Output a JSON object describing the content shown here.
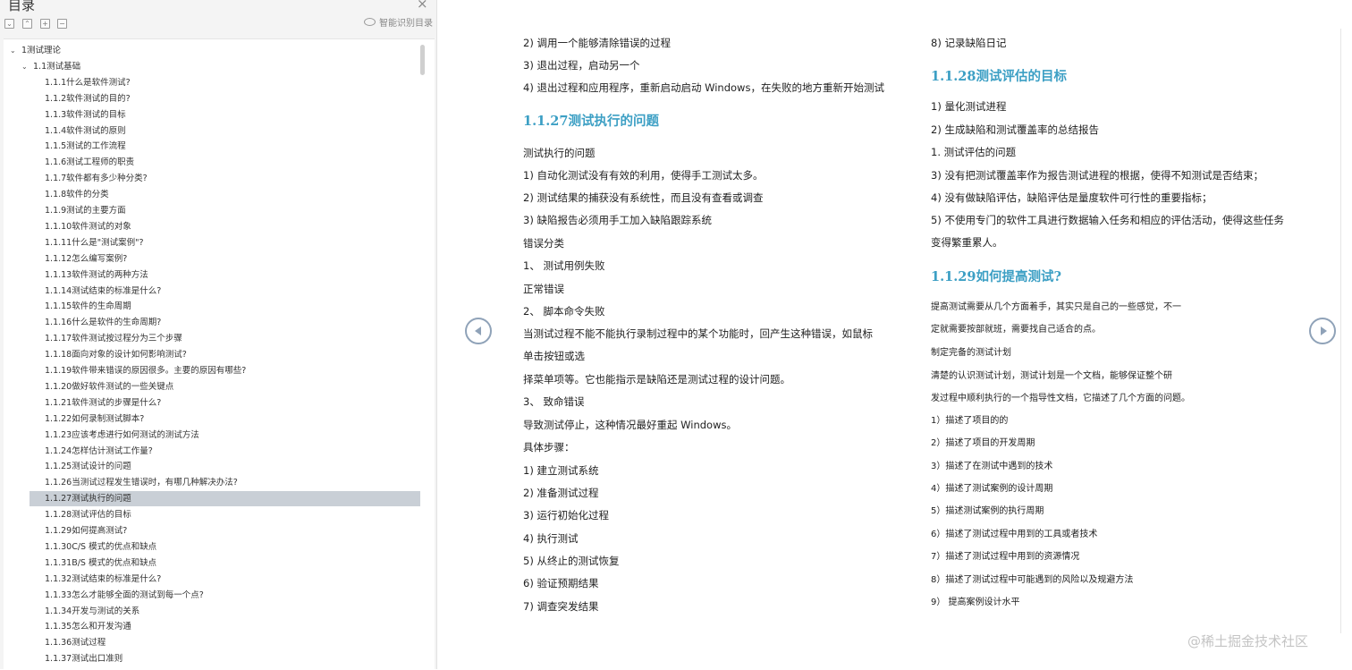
{
  "sidebar": {
    "title": "目录",
    "close_icon": "×",
    "toolbar_icons": [
      "expand-all-icon",
      "collapse-all-icon",
      "add-bookmark-icon",
      "remove-bookmark-icon"
    ],
    "smart_toc_label": "智能识别目录",
    "toc": [
      {
        "label": "1测试理论",
        "level": 0,
        "expanded": true
      },
      {
        "label": "1.1测试基础",
        "level": 1,
        "expanded": true
      },
      {
        "label": "1.1.1什么是软件测试?",
        "level": 2
      },
      {
        "label": "1.1.2软件测试的目的?",
        "level": 2
      },
      {
        "label": "1.1.3软件测试的目标",
        "level": 2
      },
      {
        "label": "1.1.4软件测试的原则",
        "level": 2
      },
      {
        "label": "1.1.5测试的工作流程",
        "level": 2
      },
      {
        "label": "1.1.6测试工程师的职责",
        "level": 2
      },
      {
        "label": "1.1.7软件都有多少种分类?",
        "level": 2
      },
      {
        "label": "1.1.8软件的分类",
        "level": 2
      },
      {
        "label": "1.1.9测试的主要方面",
        "level": 2
      },
      {
        "label": "1.1.10软件测试的对象",
        "level": 2
      },
      {
        "label": "1.1.11什么是\"测试案例\"?",
        "level": 2
      },
      {
        "label": "1.1.12怎么编写案例?",
        "level": 2
      },
      {
        "label": "1.1.13软件测试的两种方法",
        "level": 2
      },
      {
        "label": "1.1.14测试结束的标准是什么?",
        "level": 2
      },
      {
        "label": "1.1.15软件的生命周期",
        "level": 2
      },
      {
        "label": "1.1.16什么是软件的生命周期?",
        "level": 2
      },
      {
        "label": "1.1.17软件测试按过程分为三个步骤",
        "level": 2
      },
      {
        "label": "1.1.18面向对象的设计如何影响测试?",
        "level": 2
      },
      {
        "label": "1.1.19软件带来错误的原因很多。主要的原因有哪些?",
        "level": 2
      },
      {
        "label": "1.1.20做好软件测试的一些关键点",
        "level": 2
      },
      {
        "label": "1.1.21软件测试的步骤是什么?",
        "level": 2
      },
      {
        "label": "1.1.22如何录制测试脚本?",
        "level": 2
      },
      {
        "label": "1.1.23应该考虑进行如何测试的测试方法",
        "level": 2
      },
      {
        "label": "1.1.24怎样估计测试工作量?",
        "level": 2
      },
      {
        "label": "1.1.25测试设计的问题",
        "level": 2
      },
      {
        "label": "1.1.26当测试过程发生错误时，有哪几种解决办法?",
        "level": 2
      },
      {
        "label": "1.1.27测试执行的问题",
        "level": 2,
        "active": true
      },
      {
        "label": "1.1.28测试评估的目标",
        "level": 2
      },
      {
        "label": "1.1.29如何提高测试?",
        "level": 2
      },
      {
        "label": "1.1.30C/S 模式的优点和缺点",
        "level": 2
      },
      {
        "label": "1.1.31B/S 模式的优点和缺点",
        "level": 2
      },
      {
        "label": "1.1.32测试结束的标准是什么?",
        "level": 2
      },
      {
        "label": "1.1.33怎么才能够全面的测试到每一个点?",
        "level": 2
      },
      {
        "label": "1.1.34开发与测试的关系",
        "level": 2
      },
      {
        "label": "1.1.35怎么和开发沟通",
        "level": 2
      },
      {
        "label": "1.1.36测试过程",
        "level": 2
      },
      {
        "label": "1.1.37测试出口准则",
        "level": 2
      }
    ]
  },
  "document": {
    "left_column": [
      {
        "type": "text",
        "text": "2) 调用一个能够清除错误的过程"
      },
      {
        "type": "text",
        "text": "3) 退出过程，启动另一个"
      },
      {
        "type": "text",
        "text": "4) 退出过程和应用程序，重新启动启动  Windows，在失败的地方重新开始测试"
      },
      {
        "type": "heading",
        "text": "1.1.27测试执行的问题"
      },
      {
        "type": "text",
        "text": "测试执行的问题"
      },
      {
        "type": "text",
        "text": "1) 自动化测试没有有效的利用，使得手工测试太多。"
      },
      {
        "type": "text",
        "text": "2) 测试结果的捕获没有系统性，而且没有查看或调查"
      },
      {
        "type": "text",
        "text": "3) 缺陷报告必须用手工加入缺陷跟踪系统"
      },
      {
        "type": "text",
        "text": "错误分类"
      },
      {
        "type": "text",
        "text": "1、  测试用例失败"
      },
      {
        "type": "text",
        "text": "正常错误"
      },
      {
        "type": "text",
        "text": "2、  脚本命令失败"
      },
      {
        "type": "text",
        "text": "当测试过程不能不能执行录制过程中的某个功能时，回产生这种错误，如鼠标"
      },
      {
        "type": "text",
        "text": "单击按钮或选"
      },
      {
        "type": "text",
        "text": "择菜单项等。它也能指示是缺陷还是测试过程的设计问题。"
      },
      {
        "type": "text",
        "text": "3、  致命错误"
      },
      {
        "type": "text",
        "text": "导致测试停止，这种情况最好重起  Windows。"
      },
      {
        "type": "text",
        "text": "具体步骤："
      },
      {
        "type": "text",
        "text": "1) 建立测试系统"
      },
      {
        "type": "text",
        "text": "2) 准备测试过程"
      },
      {
        "type": "text",
        "text": "3) 运行初始化过程"
      },
      {
        "type": "text",
        "text": "4) 执行测试"
      },
      {
        "type": "text",
        "text": "5) 从终止的测试恢复"
      },
      {
        "type": "text",
        "text": "6) 验证预期结果"
      },
      {
        "type": "text",
        "text": "7) 调查突发结果"
      }
    ],
    "right_column": [
      {
        "type": "text",
        "text": "8) 记录缺陷日记"
      },
      {
        "type": "heading",
        "text": "1.1.28测试评估的目标"
      },
      {
        "type": "text",
        "text": "1) 量化测试进程"
      },
      {
        "type": "text",
        "text": "2) 生成缺陷和测试覆盖率的总结报告"
      },
      {
        "type": "text",
        "text": "1. 测试评估的问题"
      },
      {
        "type": "text",
        "text": "3) 没有把测试覆盖率作为报告测试进程的根据，使得不知测试是否结束；"
      },
      {
        "type": "text",
        "text": "4) 没有做缺陷评估，缺陷评估是量度软件可行性的重要指标；"
      },
      {
        "type": "text",
        "text": "5) 不使用专门的软件工具进行数据输入任务和相应的评估活动，使得这些任务"
      },
      {
        "type": "text",
        "text": "变得繁重累人。"
      },
      {
        "type": "heading",
        "text": "1.1.29如何提高测试?"
      },
      {
        "type": "small",
        "text": "提高测试需要从几个方面着手，其实只是自己的一些感觉，不一"
      },
      {
        "type": "small",
        "text": "定就需要按部就班，需要找自己适合的点。"
      },
      {
        "type": "small",
        "text": "制定完备的测试计划"
      },
      {
        "type": "small",
        "text": "清楚的认识测试计划，测试计划是一个文档，能够保证整个研"
      },
      {
        "type": "small",
        "text": "发过程中顺利执行的一个指导性文档，它描述了几个方面的问题。"
      },
      {
        "type": "small",
        "text": "1）描述了项目的的"
      },
      {
        "type": "small",
        "text": "2）描述了项目的开发周期"
      },
      {
        "type": "small",
        "text": "3）描述了在测试中遇到的技术"
      },
      {
        "type": "small",
        "text": "4）描述了测试案例的设计周期"
      },
      {
        "type": "small",
        "text": "5）描述测试案例的执行周期"
      },
      {
        "type": "small",
        "text": "6）描述了测试过程中用到的工具或者技术"
      },
      {
        "type": "small",
        "text": "7）描述了测试过程中用到的资源情况"
      },
      {
        "type": "small",
        "text": "8）描述了测试过程中可能遇到的风险以及规避方法"
      },
      {
        "type": "small",
        "text": "9）  提高案例设计水平"
      }
    ],
    "prev_icon": "chevron-left-icon",
    "next_icon": "chevron-right-icon",
    "watermark": "@稀土掘金技术社区"
  }
}
